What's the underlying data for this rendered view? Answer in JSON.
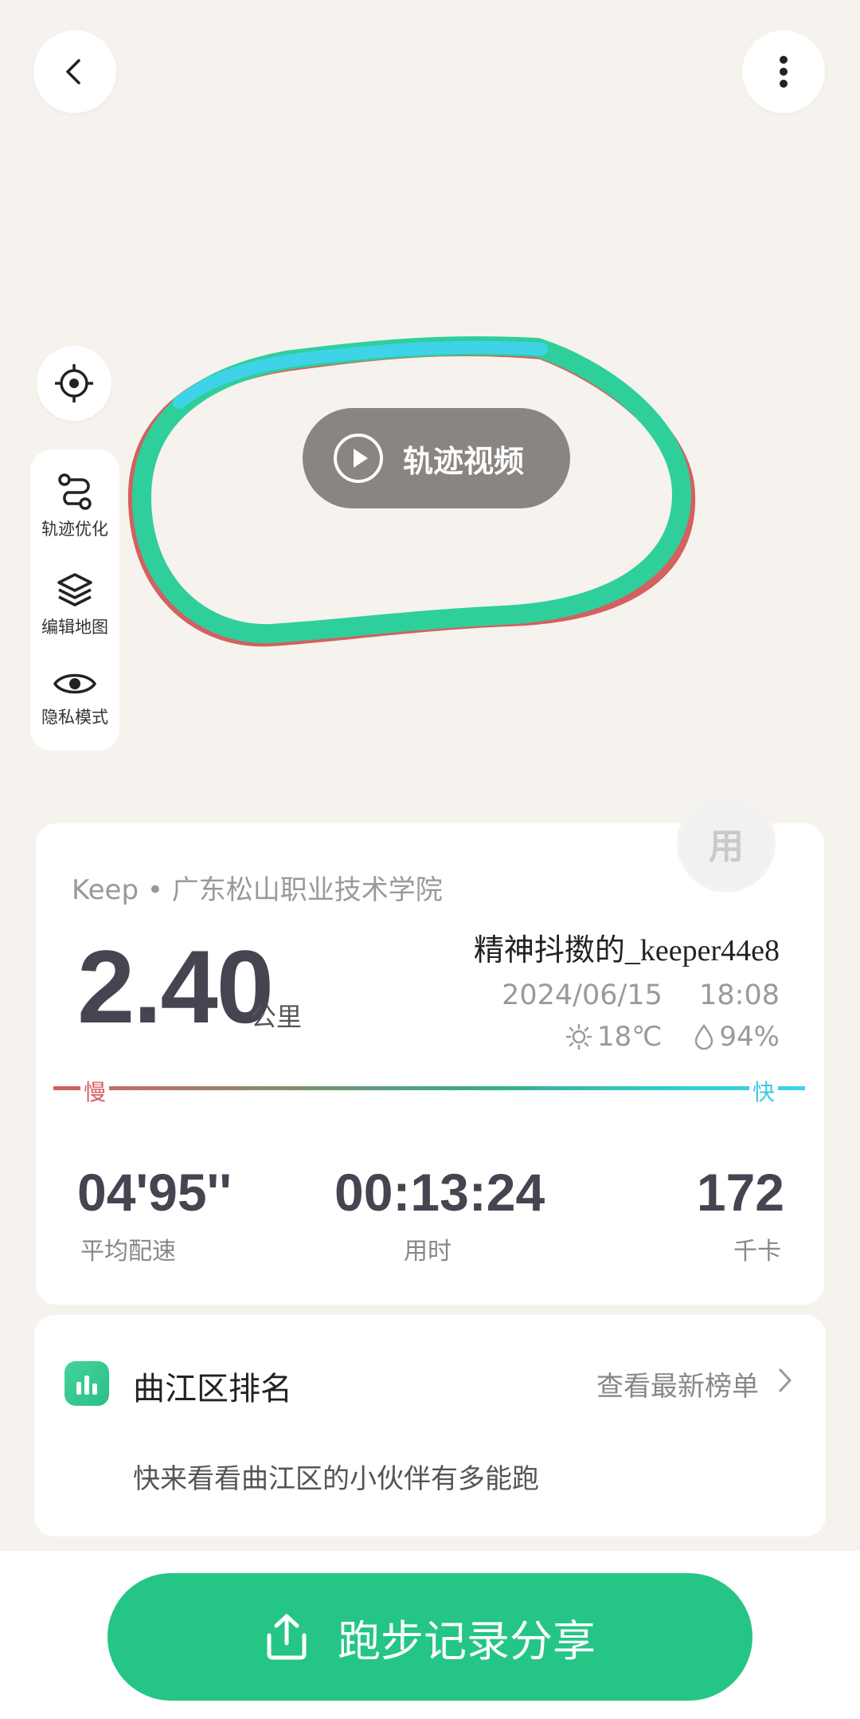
{
  "map": {
    "track_video_label": "轨迹视频",
    "tools": [
      {
        "icon": "route-optimize-icon",
        "label": "轨迹优化"
      },
      {
        "icon": "layers-icon",
        "label": "编辑地图"
      },
      {
        "icon": "eye-icon",
        "label": "隐私模式"
      }
    ]
  },
  "summary": {
    "source": "Keep • 广东松山职业技术学院",
    "avatar_text": "用",
    "distance": "2.40",
    "distance_unit": "公里",
    "username": "精神抖擞的_keeper44e8",
    "date": "2024/06/15",
    "time": "18:08",
    "temperature": "18℃",
    "humidity": "94%",
    "pace_slow": "慢",
    "pace_fast": "快",
    "stats": [
      {
        "value": "04'95''",
        "label": "平均配速"
      },
      {
        "value": "00:13:24",
        "label": "用时"
      },
      {
        "value": "172",
        "label": "千卡"
      }
    ]
  },
  "ranking": {
    "title": "曲江区排名",
    "link": "查看最新榜单",
    "description": "快来看看曲江区的小伙伴有多能跑"
  },
  "share": {
    "label": "跑步记录分享"
  },
  "colors": {
    "accent": "#24c585",
    "route": "#2fcf9c",
    "route_start": "#3fd3e8",
    "route_end": "#d4605f",
    "text_dark": "#444550"
  }
}
